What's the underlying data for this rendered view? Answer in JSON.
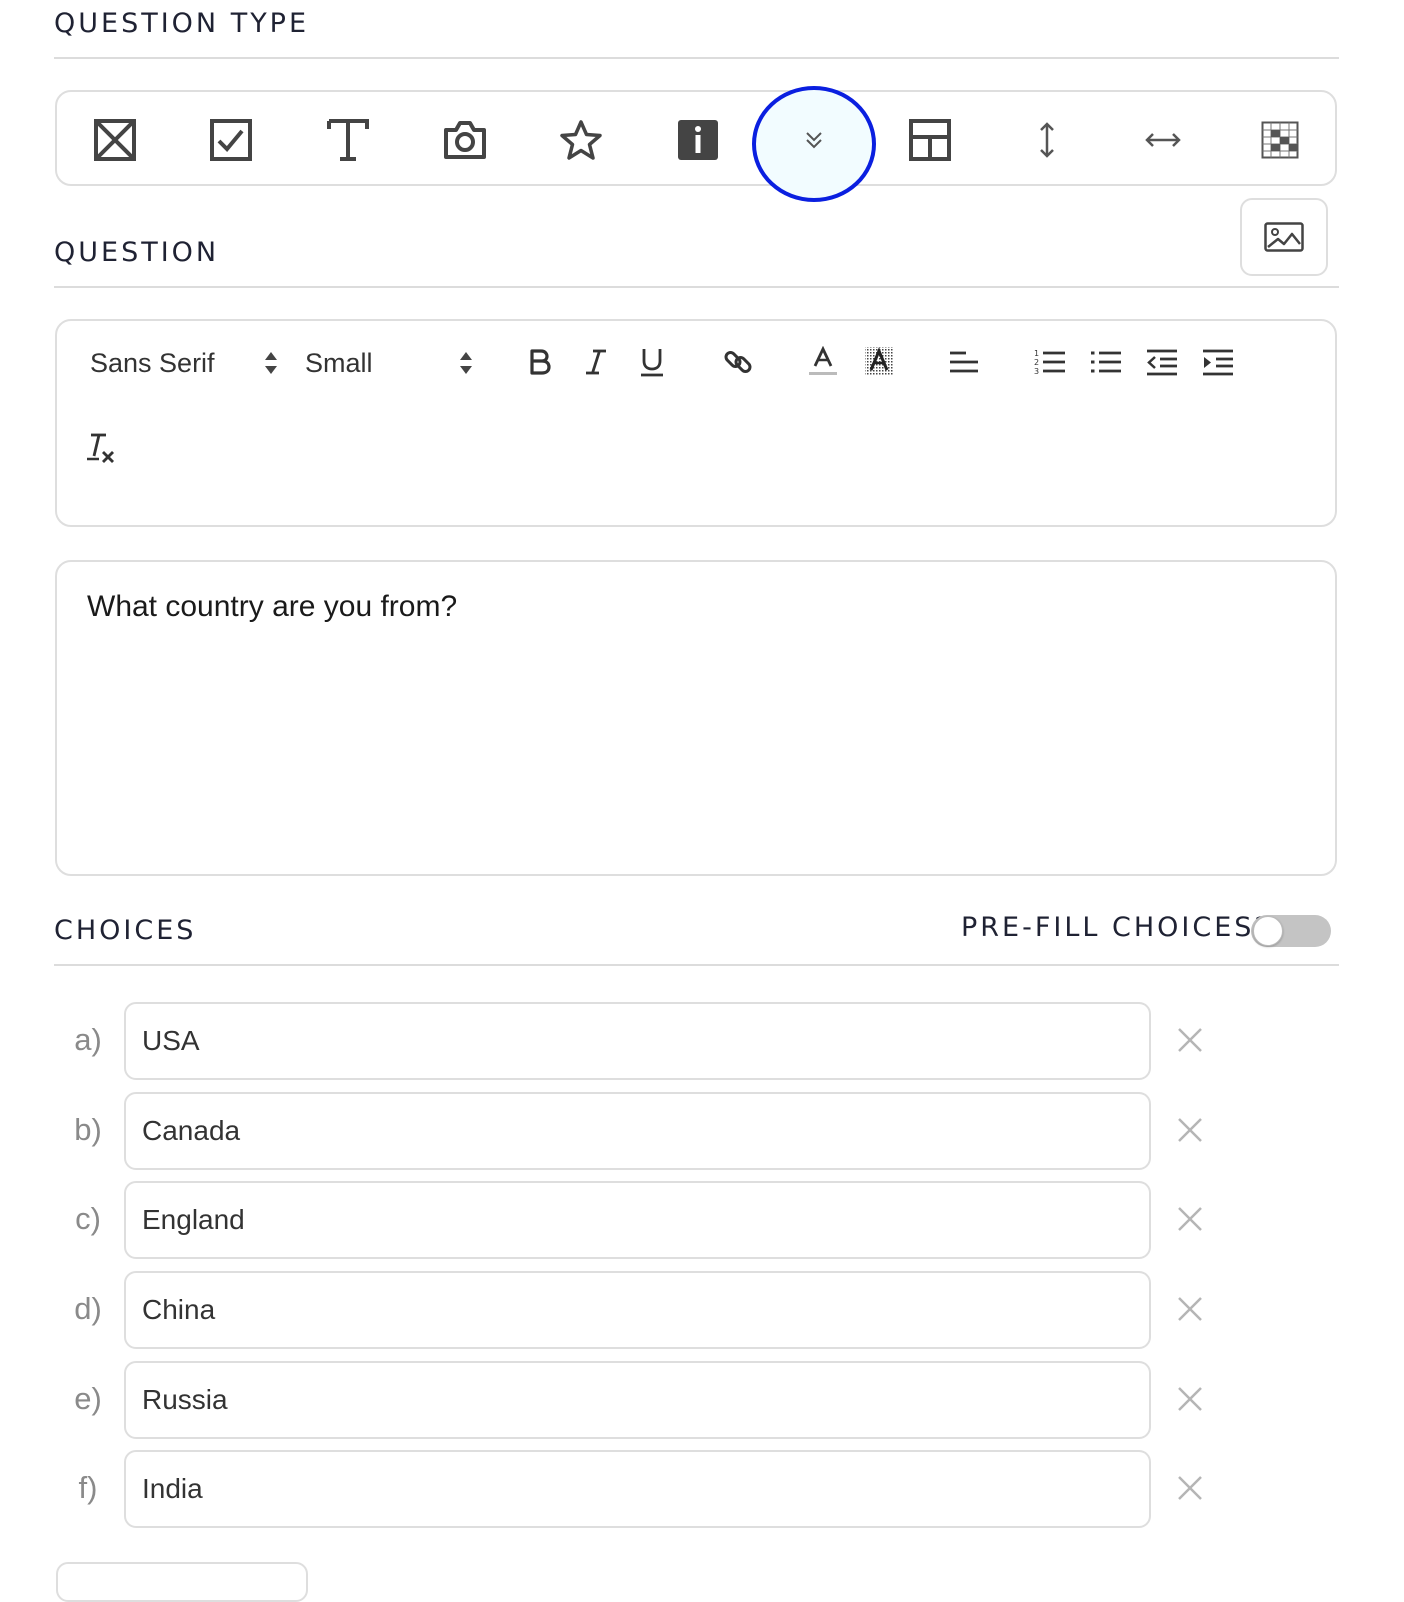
{
  "sections": {
    "question_type": "QUESTION TYPE",
    "question": "QUESTION",
    "choices": "CHOICES"
  },
  "question_types": [
    {
      "icon": "single-choice-box-icon"
    },
    {
      "icon": "checkbox-icon"
    },
    {
      "icon": "text-icon"
    },
    {
      "icon": "camera-icon"
    },
    {
      "icon": "star-icon"
    },
    {
      "icon": "info-icon"
    },
    {
      "icon": "dropdown-chevron-icon",
      "selected": true
    },
    {
      "icon": "layout-icon"
    },
    {
      "icon": "vertical-arrows-icon"
    },
    {
      "icon": "horizontal-arrows-icon"
    },
    {
      "icon": "grid-icon"
    }
  ],
  "editor": {
    "font_family": "Sans Serif",
    "font_size": "Small",
    "question_text": "What country are you from?"
  },
  "prefill": {
    "label": "PRE-FILL CHOICES?",
    "enabled": false
  },
  "choices": [
    {
      "letter": "a)",
      "value": "USA"
    },
    {
      "letter": "b)",
      "value": "Canada"
    },
    {
      "letter": "c)",
      "value": "England"
    },
    {
      "letter": "d)",
      "value": "China"
    },
    {
      "letter": "e)",
      "value": "Russia"
    },
    {
      "letter": "f)",
      "value": "India"
    }
  ],
  "colors": {
    "selection_ring": "#0a1fe0",
    "selection_fill": "#f2fcff",
    "border": "#dedede"
  }
}
